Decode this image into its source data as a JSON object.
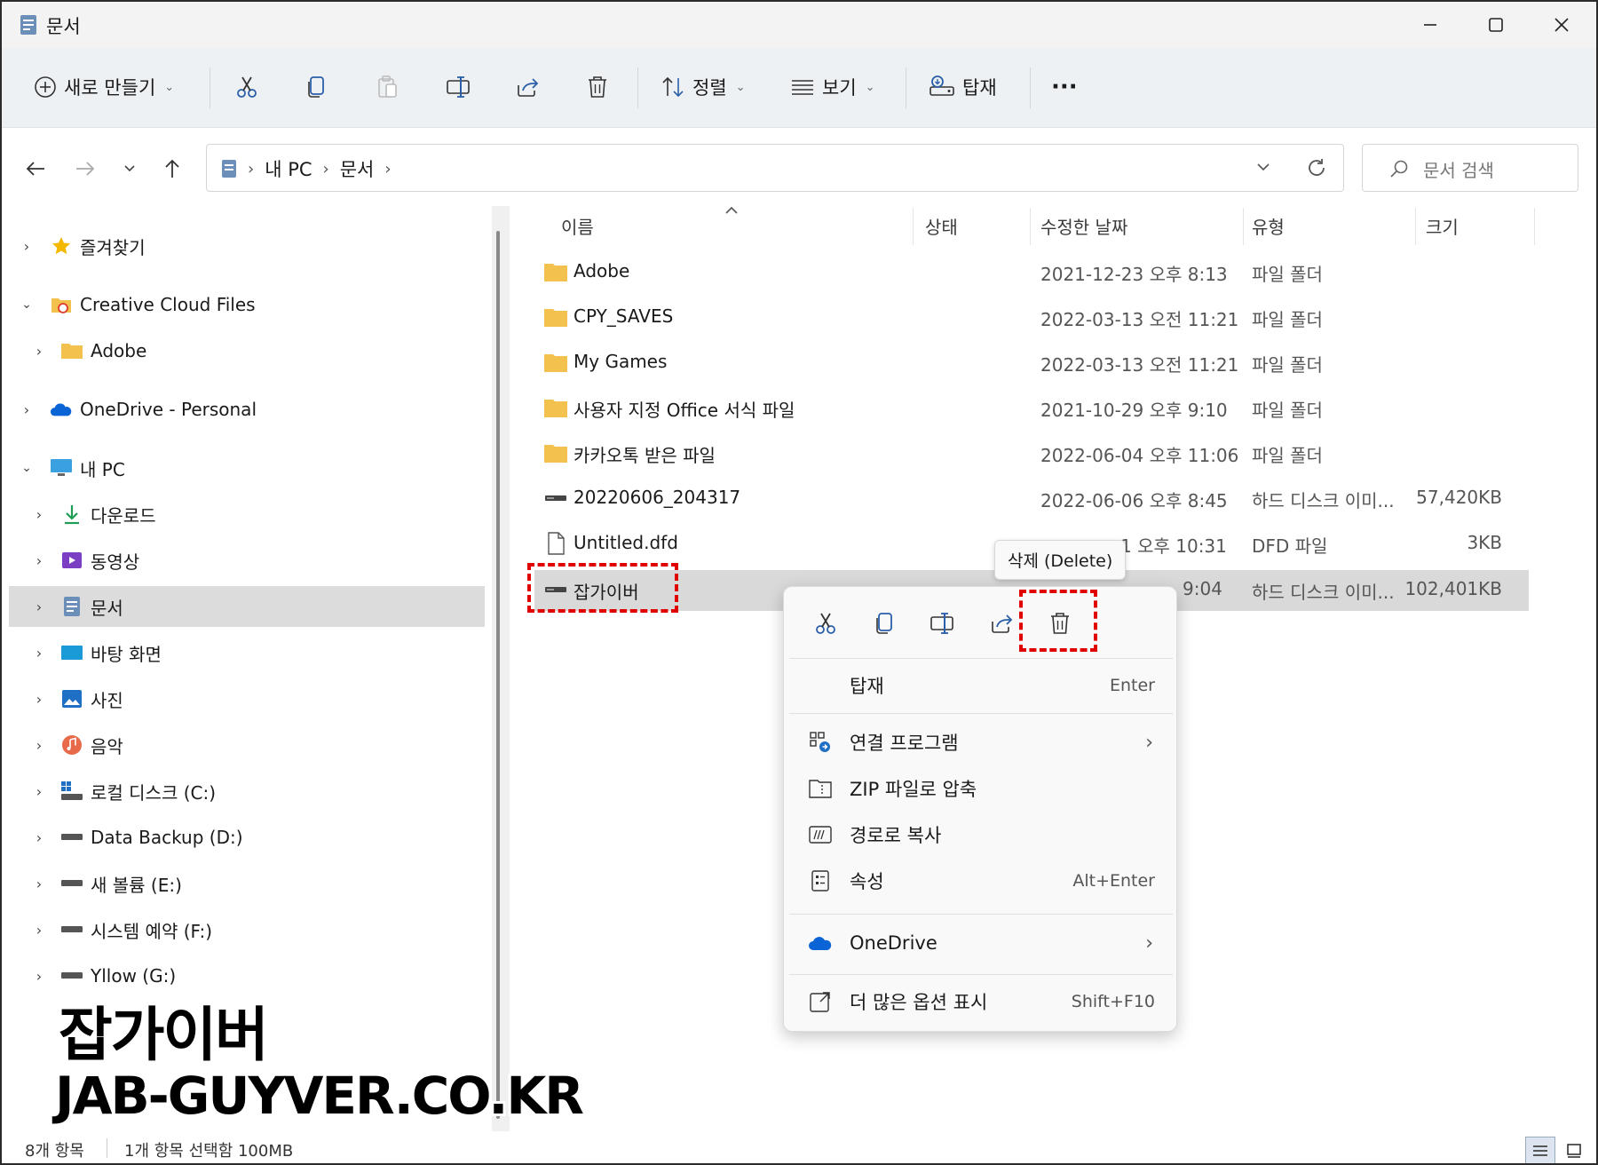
{
  "window": {
    "title": "문서",
    "icons": {
      "app": "document-icon",
      "minimize": "minimize-icon",
      "maximize": "maximize-icon",
      "close": "close-icon"
    }
  },
  "toolbar": {
    "new_label": "새로 만들기",
    "sort_label": "정렬",
    "view_label": "보기",
    "mount_label": "탑재",
    "more_label": "···"
  },
  "nav": {
    "breadcrumbs": [
      "내 PC",
      "문서"
    ],
    "search_placeholder": "문서 검색"
  },
  "sidebar": {
    "items": [
      {
        "label": "즐겨찾기",
        "icon": "star-icon"
      },
      {
        "label": "Creative Cloud Files",
        "icon": "creative-cloud-folder-icon"
      },
      {
        "label": "Adobe",
        "icon": "folder-icon"
      },
      {
        "label": "OneDrive - Personal",
        "icon": "onedrive-cloud-icon"
      },
      {
        "label": "내 PC",
        "icon": "monitor-icon"
      },
      {
        "label": "다운로드",
        "icon": "download-icon"
      },
      {
        "label": "동영상",
        "icon": "video-icon"
      },
      {
        "label": "문서",
        "icon": "document-icon"
      },
      {
        "label": "바탕 화면",
        "icon": "desktop-icon"
      },
      {
        "label": "사진",
        "icon": "picture-icon"
      },
      {
        "label": "음악",
        "icon": "music-icon"
      },
      {
        "label": "로컬 디스크 (C:)",
        "icon": "system-drive-icon"
      },
      {
        "label": "Data Backup (D:)",
        "icon": "drive-icon"
      },
      {
        "label": "새 볼륨 (E:)",
        "icon": "drive-icon"
      },
      {
        "label": "시스템 예약 (F:)",
        "icon": "drive-icon"
      },
      {
        "label": "Yllow (G:)",
        "icon": "drive-icon"
      }
    ]
  },
  "columns": {
    "name": "이름",
    "status": "상태",
    "modified": "수정한 날짜",
    "type": "유형",
    "size": "크기"
  },
  "files": [
    {
      "name": "Adobe",
      "modified": "2021-12-23 오후 8:13",
      "type": "파일 폴더",
      "size": "",
      "icon": "folder-icon"
    },
    {
      "name": "CPY_SAVES",
      "modified": "2022-03-13 오전 11:21",
      "type": "파일 폴더",
      "size": "",
      "icon": "folder-icon"
    },
    {
      "name": "My Games",
      "modified": "2022-03-13 오전 11:21",
      "type": "파일 폴더",
      "size": "",
      "icon": "folder-icon"
    },
    {
      "name": "사용자 지정 Office 서식 파일",
      "modified": "2021-10-29 오후 9:10",
      "type": "파일 폴더",
      "size": "",
      "icon": "folder-icon"
    },
    {
      "name": "카카오톡 받은 파일",
      "modified": "2022-06-04 오후 11:06",
      "type": "파일 폴더",
      "size": "",
      "icon": "folder-icon"
    },
    {
      "name": "20220606_204317",
      "modified": "2022-06-06 오후 8:45",
      "type": "하드 디스크 이미...",
      "size": "57,420KB",
      "icon": "disk-image-icon"
    },
    {
      "name": "Untitled.dfd",
      "modified": "1 오후 10:31",
      "type": "DFD 파일",
      "size": "3KB",
      "icon": "file-icon"
    },
    {
      "name": "잡가이버",
      "modified": "9:04",
      "type": "하드 디스크 이미...",
      "size": "102,401KB",
      "icon": "disk-image-icon"
    }
  ],
  "tooltip": "삭제 (Delete)",
  "context_menu": {
    "quick_actions": [
      "cut-icon",
      "copy-icon",
      "rename-icon",
      "share-icon",
      "delete-icon"
    ],
    "items": [
      {
        "label": "탑재",
        "shortcut": "Enter",
        "icon": ""
      },
      {
        "label": "연결 프로그램",
        "shortcut": "",
        "icon": "open-with-icon",
        "submenu": true
      },
      {
        "label": "ZIP 파일로 압축",
        "shortcut": "",
        "icon": "zip-icon"
      },
      {
        "label": "경로로 복사",
        "shortcut": "",
        "icon": "copy-path-icon"
      },
      {
        "label": "속성",
        "shortcut": "Alt+Enter",
        "icon": "properties-icon"
      },
      {
        "label": "OneDrive",
        "shortcut": "",
        "icon": "onedrive-cloud-icon",
        "submenu": true
      },
      {
        "label": "더 많은 옵션 표시",
        "shortcut": "Shift+F10",
        "icon": "more-options-icon"
      }
    ]
  },
  "watermark": {
    "line1": "잡가이버",
    "line2": "JAB-GUYVER.CO.KR"
  },
  "status": {
    "count": "8개 항목",
    "selection": "1개 항목 선택함 100MB"
  },
  "colors": {
    "accent": "#0067c0",
    "folder": "#f2c14e",
    "highlight": "#e00000",
    "selected_row": "#d9d9d9"
  }
}
